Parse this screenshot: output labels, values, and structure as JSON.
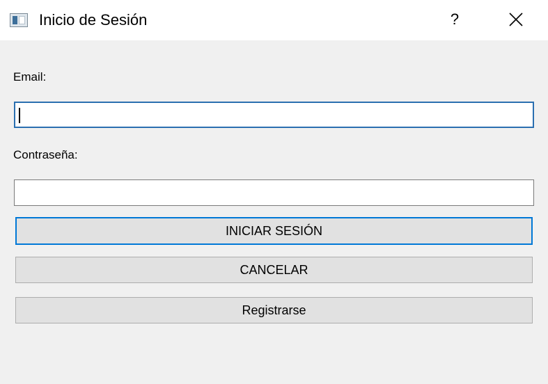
{
  "window": {
    "title": "Inicio de Sesión",
    "help_label": "?",
    "icons": {
      "app": "app-window-icon",
      "close": "close-icon"
    }
  },
  "form": {
    "email_label": "Email:",
    "email_value": "",
    "password_label": "Contraseña:",
    "password_value": ""
  },
  "buttons": {
    "login": "INICIAR SESIÓN",
    "cancel": "CANCELAR",
    "register": "Registrarse"
  },
  "colors": {
    "focus_accent": "#0078d7",
    "window_background": "#f0f0f0",
    "button_background": "#e1e1e1"
  }
}
